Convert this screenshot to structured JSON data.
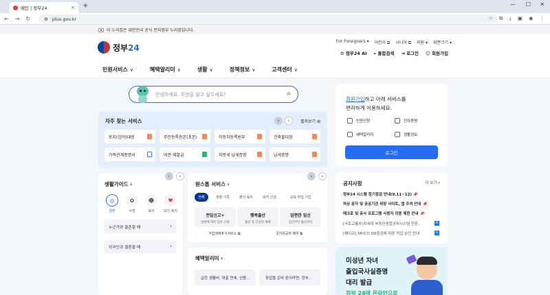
{
  "browser": {
    "tab_title": "메인 | 정부24",
    "tab_close": "×",
    "new_tab": "+",
    "url": "plus.gov.kr",
    "controls": {
      "min": "—",
      "max": "☐",
      "close": "✕"
    },
    "nav_glyphs": {
      "back": "←",
      "forward": "→",
      "reload": "↻",
      "site_info": "⚙"
    },
    "bar_glyphs": {
      "star": "☆",
      "extensions": "⧉",
      "download": "⤓",
      "panel": "▣",
      "profile": "◉",
      "menu": "⋮"
    }
  },
  "gov_notice": "이 누리집은 대한민국 공식 전자정부 누리집입니다.",
  "logo": {
    "text": "정부",
    "num": "24"
  },
  "util_links": [
    "For Foreigners ▾",
    "어린이 ⧉",
    "시니어 ⧉",
    "지원 ▾",
    "화면크기 ▾"
  ],
  "util_actions": [
    "정부24 AI",
    "통합검색",
    "로그인",
    "회원가입"
  ],
  "nav": [
    {
      "label": "민원서비스",
      "ch": "∨"
    },
    {
      "label": "혜택알리미",
      "ch": "∨"
    },
    {
      "label": "생활",
      "ch": "∨"
    },
    {
      "label": "정책정보",
      "ch": "∨"
    },
    {
      "label": "고객센터",
      "ch": "∨"
    }
  ],
  "search": {
    "placeholder": "안녕하세요. 무엇을 알고 싶으세요?",
    "glyph": "⌕"
  },
  "frequent": {
    "title": "자주 찾는 서비스",
    "prev": "‹",
    "next": "›",
    "more": "펼쳐보기 ⊞",
    "items": [
      "토지(임야)대장",
      "주민등록등본(초본)",
      "자동차등록원부",
      "건축물대장",
      "가족관계증명서",
      "여권 재발급",
      "지방세 납세증명",
      "납세증명"
    ]
  },
  "guide": {
    "title": "생활가이드 ›",
    "prev": "‹",
    "next": "›",
    "icons": [
      {
        "label": "결혼",
        "glyph": "◎"
      },
      {
        "label": "사망",
        "glyph": "✿"
      },
      {
        "label": "육아",
        "glyph": "☻"
      },
      {
        "label": "보건·복지",
        "glyph": "♥"
      }
    ],
    "buttons": [
      "누군가와 결혼할 때",
      "외국인과 결혼할 때"
    ],
    "chev": "›"
  },
  "onestop": {
    "title": "원스톱 서비스 ›",
    "prev": "‹",
    "next": "›",
    "chips": [
      "전체",
      "생활·가족",
      "출산·육아",
      "복지·건강",
      "교육·취업·기업"
    ],
    "cards": [
      {
        "t": "전입신고+",
        "s": "한번에 여러 업무 신청"
      },
      {
        "t": "행복출산",
        "s": "출산 후 다양한 혜택"
      },
      {
        "t": "임편한 임신",
        "s": "임신부터 출산까지"
      }
    ],
    "links": [
      "기업생애주기서비스 ⧉",
      "국가유공자 예우 ⧉"
    ]
  },
  "benefit": {
    "title": "혜택알리미 ›",
    "cards": [
      "급한 생활비, 대출 연체, 신용…",
      "창업을 준비 중이라면, 정부…"
    ]
  },
  "login": {
    "link": "회원가입",
    "line1": "하고 아래 서비스를",
    "line2": "편리하게 이용하세요.",
    "items": [
      "민원신청",
      "전자증명",
      "혜택알리미",
      "생활정보"
    ],
    "button": "로그인"
  },
  "notice": {
    "title": "공지사항",
    "more": "더 보기→",
    "pin": "📌",
    "badge": "N",
    "items": [
      {
        "text": "정부24 시스템 정기점검 안내(9.11~12)",
        "pin": true
      },
      {
        "text": "피싱 문자 및 공공기관 위장 사이트, 앱 주의 안내",
        "pin": true
      },
      {
        "text": "매크로 및 유사 프로그램 사용자 이용 제한 안내",
        "pin": true
      },
      {
        "text": "[국토교통부]차세대 부동산종합공부시스템 전환…",
        "badge": true
      },
      {
        "text": "[페이코] PAYCO DB점검에 따른 작업 순단 안내",
        "badge": true
      }
    ]
  },
  "banner": {
    "line1": "미성년 자녀",
    "line2": "출입국사실증명",
    "line3": "대리 발급",
    "line4": "정부 24에 온라인으로"
  }
}
